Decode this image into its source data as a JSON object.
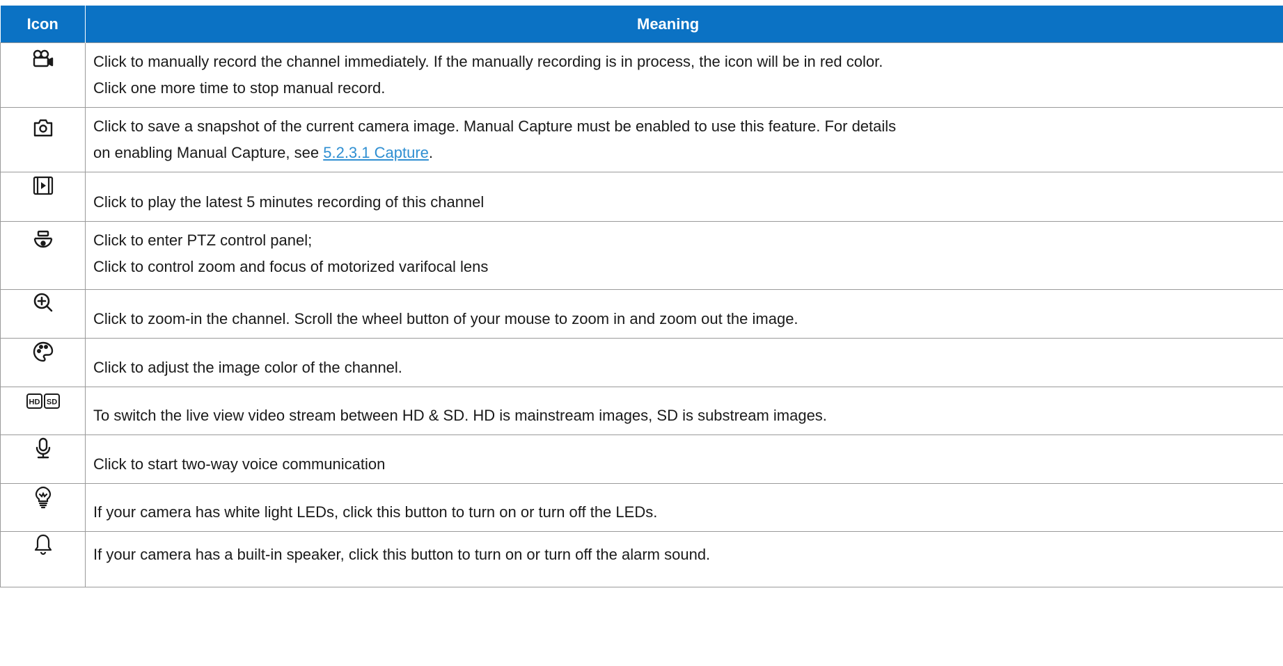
{
  "table": {
    "headers": {
      "icon": "Icon",
      "meaning": "Meaning"
    },
    "rows": [
      {
        "icon": "video-record-icon",
        "lines": [
          "Click to manually record the channel immediately. If the manually recording is in process, the icon will be in red color.",
          "Click one more time to stop manual record."
        ]
      },
      {
        "icon": "camera-snapshot-icon",
        "lines": [
          "Click to save a snapshot of the current camera image. Manual Capture must be enabled to use this feature. For details",
          "on enabling Manual Capture, see "
        ],
        "link": "5.2.3.1 Capture",
        "after_link": "."
      },
      {
        "icon": "playback-icon",
        "lines": [
          "Click to play the latest 5 minutes recording of this channel"
        ]
      },
      {
        "icon": "ptz-dome-camera-icon",
        "lines": [
          "Click to enter PTZ control panel;",
          "Click to control zoom and focus of motorized varifocal lens"
        ]
      },
      {
        "icon": "zoom-in-icon",
        "lines": [
          "Click to zoom-in the channel. Scroll the wheel button of your mouse to zoom in and zoom out the image."
        ]
      },
      {
        "icon": "color-palette-icon",
        "lines": [
          "Click to adjust the image color of the channel."
        ]
      },
      {
        "icon": "hd-sd-icon",
        "icon_text": [
          "HD",
          "SD"
        ],
        "lines": [
          "To switch the live view video stream between HD & SD. HD is mainstream images, SD is substream images."
        ]
      },
      {
        "icon": "microphone-icon",
        "lines": [
          "Click to start two-way voice communication"
        ]
      },
      {
        "icon": "light-bulb-icon",
        "lines": [
          "If your camera has white light LEDs, click this button to turn on or turn off the LEDs."
        ]
      },
      {
        "icon": "alarm-bell-icon",
        "lines": [
          "If your camera has a built-in speaker, click this button to turn on or turn off the alarm sound."
        ]
      }
    ]
  },
  "colors": {
    "header_bg": "#0b72c4",
    "header_text": "#ffffff",
    "border": "#9a9a9a",
    "link": "#2f8fd2"
  }
}
